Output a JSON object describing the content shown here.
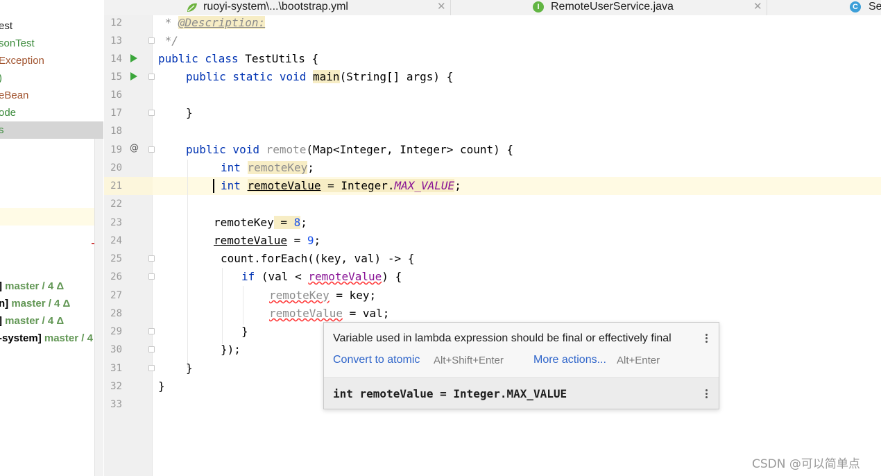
{
  "left_panel": {
    "items": [
      {
        "label": "est",
        "color": "#1e1e1e"
      },
      {
        "label": "sonTest",
        "color": "#3a8a3a"
      },
      {
        "label": "Exception",
        "color": "#a0522d"
      },
      {
        "label": ")",
        "color": "#3a8a3a"
      },
      {
        "label": "eBean",
        "color": "#a0522d"
      },
      {
        "label": "ode",
        "color": "#3a8a3a"
      },
      {
        "label": "s",
        "color": "#3a8a3a"
      }
    ],
    "vcs_items": [
      {
        "prefix": "]",
        "branch": "master / 4 Δ"
      },
      {
        "prefix": "n]",
        "branch": "master / 4 Δ"
      },
      {
        "prefix": "]",
        "branch": "master / 4 Δ"
      },
      {
        "prefix": "-system]",
        "branch": "master / 4 Δ"
      }
    ]
  },
  "tabs": [
    {
      "label": "ruoyi-system\\...\\bootstrap.yml",
      "icon": "yaml-leaf-icon"
    },
    {
      "label": "RemoteUserService.java",
      "icon": "interface-icon",
      "icon_letter": "I"
    },
    {
      "label": "Se",
      "icon": "class-icon",
      "icon_letter": "C"
    }
  ],
  "editor": {
    "line_numbers": [
      "12",
      "13",
      "14",
      "15",
      "16",
      "17",
      "18",
      "19",
      "20",
      "21",
      "22",
      "23",
      "24",
      "25",
      "26",
      "27",
      "28",
      "29",
      "30",
      "31",
      "32",
      "33"
    ],
    "lines": {
      "l12_star": " * ",
      "l12_tag": "@Description:",
      "l13": " */",
      "l14_kw": "public class",
      "l14_rest": " TestUtils {",
      "l15_kw": "public static void",
      "l15_name": "main",
      "l15_rest": "(String[] args) {",
      "l17": "}",
      "l19_kw": "public void",
      "l19_name": "remote",
      "l19_rest": "(Map<Integer, Integer> count) {",
      "l20_kw": "int",
      "l20_var": "remoteKey",
      "l20_end": ";",
      "l21_kw": "int",
      "l21_var": "remoteValue",
      "l21_eq": " = Integer.",
      "l21_const": "MAX_VALUE",
      "l21_end": ";",
      "l23_var": "remoteKey",
      "l23_eq": " = ",
      "l23_num": "8",
      "l23_end": ";",
      "l24_var": "remoteValue",
      "l24_eq": " = ",
      "l24_num": "9",
      "l24_end": ";",
      "l25": "count.forEach((key, val) -> {",
      "l26_kw": "if",
      "l26_mid": " (val < ",
      "l26_var": "remoteValue",
      "l26_end": ") {",
      "l27_var": "remoteKey",
      "l27_rest": " = key;",
      "l28_var": "remoteValue",
      "l28_rest": " = val;",
      "l29": "}",
      "l30": "});",
      "l31": "}",
      "l32": "}"
    }
  },
  "popup": {
    "message": "Variable used in lambda expression should be final or effectively final",
    "action1_label": "Convert to atomic",
    "action1_shortcut": "Alt+Shift+Enter",
    "action2_label": "More actions...",
    "action2_shortcut": "Alt+Enter",
    "declaration": "int remoteValue = Integer.MAX_VALUE"
  },
  "watermark": "CSDN @可以简单点",
  "colors": {
    "keyword": "#0033b3",
    "number": "#1750eb",
    "link": "#2f65ca",
    "run_icon": "#3aa63a"
  }
}
